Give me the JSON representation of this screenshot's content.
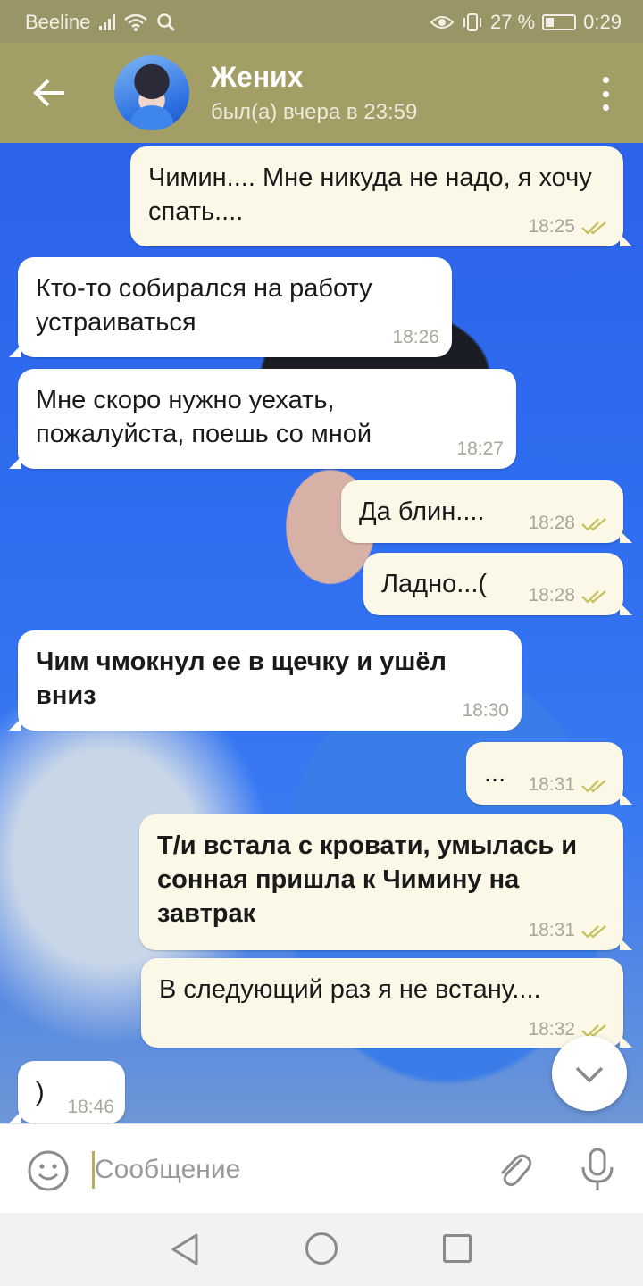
{
  "status_bar": {
    "carrier": "Beeline",
    "battery": "27 %",
    "time": "0:29",
    "icons": [
      "signal-icon",
      "wifi-icon",
      "search-icon",
      "eye-icon",
      "vibrate-icon",
      "battery-charging-icon"
    ]
  },
  "header": {
    "name": "Жених",
    "status": "был(а) вчера в 23:59",
    "back_icon": "arrow-back-icon",
    "menu_icon": "more-vert-icon"
  },
  "messages": [
    {
      "dir": "out",
      "text": "Чимин.... Мне никуда не надо, я хочу спать....",
      "time": "18:25",
      "read": true
    },
    {
      "dir": "in",
      "text": "Кто-то собирался на работу устраиваться",
      "time": "18:26"
    },
    {
      "dir": "in",
      "text": "Мне скоро нужно уехать, пожалуйста, поешь со мной",
      "time": "18:27"
    },
    {
      "dir": "out",
      "text": "Да блин....",
      "time": "18:28",
      "read": true
    },
    {
      "dir": "out",
      "text": "Ладно...(",
      "time": "18:28",
      "read": true
    },
    {
      "dir": "in",
      "text": "Чим чмокнул ее в щечку и ушёл вниз",
      "time": "18:30",
      "bold": true
    },
    {
      "dir": "out",
      "text": "...",
      "time": "18:31",
      "read": true
    },
    {
      "dir": "out",
      "text": "Т/и встала с кровати, умылась и сонная пришла к Чимину на завтрак",
      "time": "18:31",
      "read": true,
      "bold": true
    },
    {
      "dir": "out",
      "text": "В следующий раз я не встану....",
      "time": "18:32",
      "read": true
    },
    {
      "dir": "in",
      "text": ")",
      "time": "18:46"
    }
  ],
  "input": {
    "placeholder": "Сообщение",
    "emoji_icon": "emoji-icon",
    "attach_icon": "paperclip-icon",
    "mic_icon": "microphone-icon"
  },
  "colors": {
    "header": "#a39e66",
    "status_bar": "#9a9566",
    "bubble_out": "#fbf8e8",
    "bubble_in": "#ffffff",
    "read_ticks": "#c8bf5a"
  }
}
